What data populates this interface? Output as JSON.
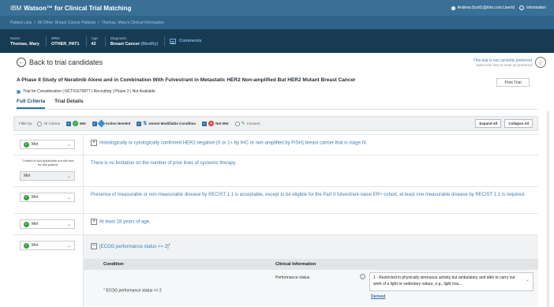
{
  "app": {
    "brand_prefix": "IBM",
    "brand_name": "Watson™ for Clinical Trial Matching",
    "user": "Andrew.Scott1@ibm.com,UserId",
    "info_label": "Information"
  },
  "breadcrumb": [
    "Patient Lists",
    "/",
    "All Other: Breast Cancer Patients",
    "/",
    "Thomas, Mary's Clinical Information"
  ],
  "patient": {
    "name_label": "Name:",
    "name": "Thomas, Mary",
    "mrn_label": "MRN:",
    "mrn": "OTHER_PAT1",
    "age_label": "Age:",
    "age": "42",
    "diag_label": "Diagnosis:",
    "diagnosis": "Breast Cancer",
    "modify": "(Modify)",
    "comments": "Comments"
  },
  "back": "Back to trial candidates",
  "preferred": {
    "line1": "This trial is not currently preferred",
    "line2": "Select the star to mark as preferred"
  },
  "trial": {
    "title": "A Phase II Study of Neratinib Alone and in Combination With Fulvestrant in Metastatic HER2 Non-amplified But HER2 Mutant Breast Cancer",
    "status": "Trial for Consideration | NCT01670877 | Recruiting | Phase 2 | Not Available",
    "print": "Print Trial"
  },
  "tabs": [
    "Full Criteria",
    "Trial Details"
  ],
  "filter": {
    "label": "Filter by:",
    "all": "All Criteria",
    "met": "Met",
    "action": "Action Needed",
    "unmet_mod": "Unmet Modifiable Condition",
    "not_met": "Not Met",
    "consent": "Consent",
    "expand": "Expand All",
    "collapse": "Collapse All"
  },
  "criteria": [
    {
      "status": "Met",
      "text": "Histologically or cytologically confirmed HER2-negative (0 or 1+ by IHC or non-amplified by FISH) breast cancer that is stage IV."
    },
    {
      "note": "Criteria is Not Applicable but still met for this patient.",
      "status": "Met",
      "text": "There is no limitation on the number of prior lines of systemic therapy."
    },
    {
      "status": "Met",
      "text": "Presence of measurable or non-measurable disease by RECIST 1.1 is acceptable, except to be eligible for the Part II fulvestrant-naive ER+ cohort, at least one measurable disease by RECIST 1.1 is required."
    },
    {
      "status": "Met",
      "text": "At least 18 years of age."
    },
    {
      "status": "Met",
      "text": "[ECOG performance status <= 2]",
      "sup": "1"
    }
  ],
  "ecog": {
    "col_condition": "Condition",
    "col_info": "Clinical Information",
    "cond_sup": "1",
    "condition": "ECOG performance status <= 2",
    "info_label": "Performance status",
    "value": "1 - Restricted in physically strenuous activity but ambulatory and able to carry out work of a light or sedentary nature, e.g., light hou...",
    "derived": "Derived"
  },
  "colors": {
    "topbar": "#3a6f96",
    "patientbar": "#173b52",
    "met": "#3a9f3e",
    "link": "#3d7db3"
  }
}
